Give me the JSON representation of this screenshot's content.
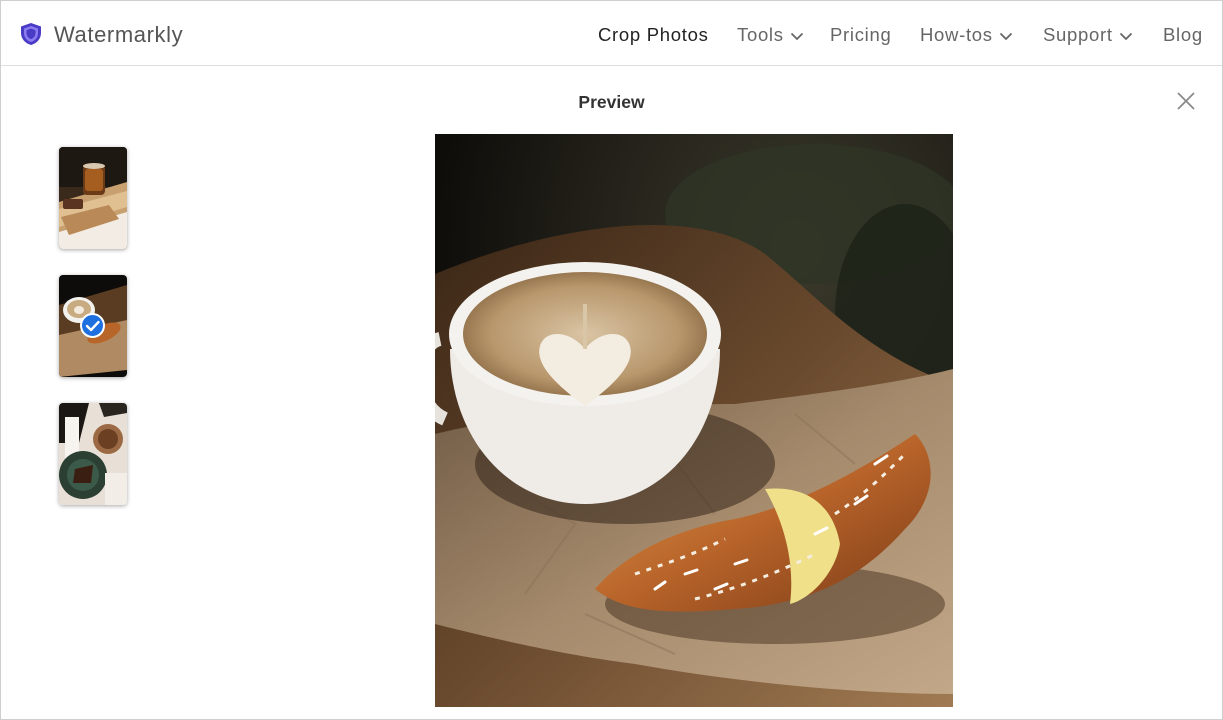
{
  "header": {
    "brand": "Watermarkly",
    "logo_icon": "shield-icon",
    "nav": [
      {
        "label": "Crop Photos",
        "dropdown": false,
        "active": true
      },
      {
        "label": "Tools",
        "dropdown": true,
        "active": false
      },
      {
        "label": "Pricing",
        "dropdown": false,
        "active": false
      },
      {
        "label": "How-tos",
        "dropdown": true,
        "active": false
      },
      {
        "label": "Support",
        "dropdown": true,
        "active": false
      },
      {
        "label": "Blog",
        "dropdown": false,
        "active": false
      }
    ]
  },
  "preview": {
    "title": "Preview",
    "close_icon": "close-icon",
    "selected_thumbnail": 2,
    "thumbnails": [
      {
        "subject": "iced coffee and cake on wooden tray"
      },
      {
        "subject": "latte and croissant"
      },
      {
        "subject": "coffee and dessert on dark plate"
      }
    ],
    "main_photo_subject": "latte with heart art and croissant on parchment paper"
  },
  "colors": {
    "logo_purple": "#5b3fd6",
    "check_blue": "#1e6fe0",
    "active_nav": "#222222",
    "nav_text": "#666666"
  }
}
